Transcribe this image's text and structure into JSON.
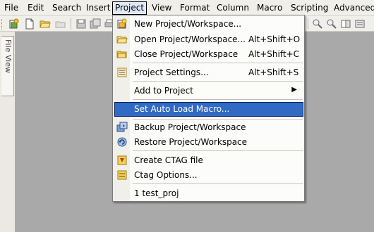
{
  "menubar": {
    "items": [
      "File",
      "Edit",
      "Search",
      "Insert",
      "Project",
      "View",
      "Format",
      "Column",
      "Macro",
      "Scripting",
      "Advanced"
    ],
    "active": "Project"
  },
  "side_panel": {
    "tab_label": "File View"
  },
  "toolbar": {
    "icons": [
      "new-project-icon",
      "new-file-icon",
      "open-folder-icon",
      "open-disabled-icon",
      "save-icon",
      "save-all-icon",
      "print-icon"
    ]
  },
  "project_menu": {
    "items": [
      {
        "label": "New Project/Workspace...",
        "shortcut": "",
        "icon": "new-project-icon"
      },
      {
        "label": "Open Project/Workspace...",
        "shortcut": "Alt+Shift+O",
        "icon": "open-project-icon"
      },
      {
        "label": "Close Project/Workspace",
        "shortcut": "Alt+Shift+C",
        "icon": "close-project-icon"
      },
      {
        "label": "Project Settings...",
        "shortcut": "Alt+Shift+S",
        "icon": "project-settings-icon"
      },
      {
        "label": "Add to Project",
        "shortcut": "",
        "icon": "",
        "submenu_arrow": "▶"
      },
      {
        "label": "Set Auto Load Macro...",
        "shortcut": "",
        "icon": "",
        "highlighted": true
      },
      {
        "label": "Backup Project/Workspace",
        "shortcut": "",
        "icon": "backup-icon"
      },
      {
        "label": "Restore Project/Workspace",
        "shortcut": "",
        "icon": "restore-icon"
      },
      {
        "label": "Create CTAG file",
        "shortcut": "",
        "icon": "ctag-icon"
      },
      {
        "label": "Ctag Options...",
        "shortcut": "",
        "icon": "ctag-options-icon"
      },
      {
        "label": "1 test_proj",
        "shortcut": "",
        "icon": ""
      }
    ]
  },
  "colors": {
    "highlight": "#316ac5",
    "menubar": "#f0efea",
    "workspace": "#a9a9a9"
  }
}
